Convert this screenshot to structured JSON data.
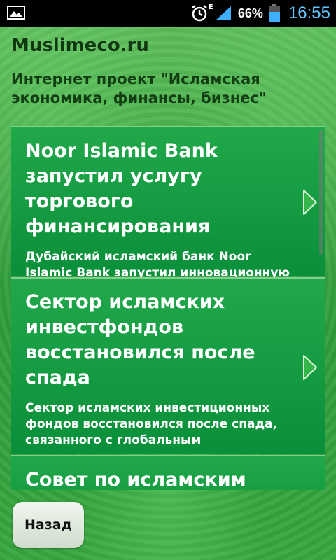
{
  "status_bar": {
    "battery_percent": "66%",
    "battery_level": 0.66,
    "network_type": "E",
    "time": "16:55",
    "icons": [
      "gallery-icon",
      "alarm-icon",
      "signal-icon",
      "battery-icon"
    ],
    "time_color": "#5fc7ff"
  },
  "header": {
    "title": "Muslimeco.ru",
    "subtitle": "Интернет проект \"Исламская экономика, финансы, бизнес\""
  },
  "news": [
    {
      "title": "Noor Islamic Bank запустил услугу торгового финансирования",
      "description": "Дубайский исламский банк Noor Islamic Bank запустил инновационную финансовую услугу,"
    },
    {
      "title": "Сектор исламских инвестфондов восстановился после спада",
      "description": "Сектор исламских инвестиционных фондов восстановился после спада, связанного с глобальным"
    },
    {
      "title": "Совет по исламским",
      "description": ""
    }
  ],
  "footer": {
    "back_label": "Назад"
  },
  "colors": {
    "card_background": "#0a8f3a",
    "title_text": "#0f3a10",
    "status_bar": "#000000"
  }
}
